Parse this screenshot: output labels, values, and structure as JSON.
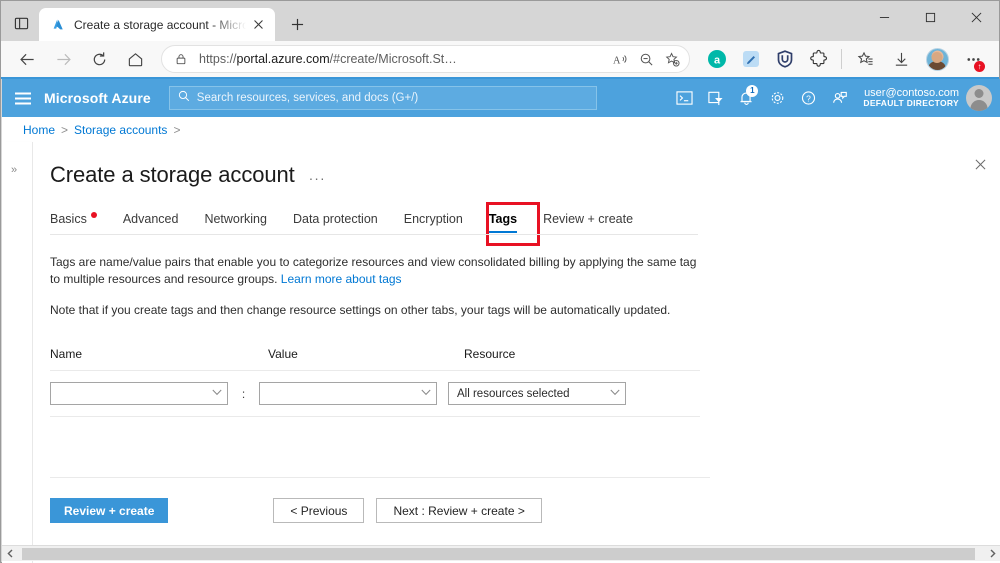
{
  "browser": {
    "tab": {
      "title": "Create a storage account - Micro",
      "favicon_icon": "azure-logo-icon",
      "close_icon": "close-icon"
    },
    "newtab_label": "+",
    "tab_list_icon": "tab-list-icon",
    "window_controls": {
      "minimize": "minimize-icon",
      "maximize": "maximize-icon",
      "close": "close-icon"
    },
    "toolbar": {
      "back_icon": "back-arrow-icon",
      "forward_icon": "forward-arrow-icon",
      "refresh_icon": "refresh-icon",
      "home_icon": "home-icon",
      "lock_icon": "lock-icon",
      "url_prefix": "https://",
      "url_host": "portal.azure.com",
      "url_path": "/#create/Microsoft.St…",
      "read_aloud_icon": "read-aloud-icon",
      "zoom_out_icon": "zoom-out-icon",
      "add_favorite_icon": "add-favorite-icon",
      "extensions": [
        {
          "name": "alexa-extension-icon",
          "letter": "a"
        },
        {
          "name": "editor-extension-icon",
          "letter": ""
        },
        {
          "name": "ublock-extension-icon",
          "letter": ""
        },
        {
          "name": "puzzle-extensions-icon",
          "letter": ""
        }
      ],
      "favorites_icon": "favorites-icon",
      "downloads_icon": "downloads-icon",
      "profile_icon": "profile-avatar-icon",
      "settings_more_icon": "settings-and-more-icon"
    }
  },
  "azure": {
    "header": {
      "menu_icon": "hamburger-menu-icon",
      "brand": "Microsoft Azure",
      "search_placeholder": "Search resources, services, and docs (G+/)",
      "search_value": "",
      "search_icon": "search-icon",
      "icons": [
        {
          "name": "cloud-shell-icon"
        },
        {
          "name": "directories-subscriptions-icon"
        },
        {
          "name": "notifications-bell-icon",
          "badge": "1"
        },
        {
          "name": "settings-gear-icon"
        },
        {
          "name": "help-question-icon"
        },
        {
          "name": "feedback-icon"
        }
      ],
      "account": "user@contoso.com",
      "directory": "DEFAULT DIRECTORY",
      "avatar_icon": "user-avatar-icon"
    },
    "breadcrumb": {
      "items": [
        "Home",
        "Storage accounts"
      ],
      "separator": ">"
    },
    "blade": {
      "title": "Create a storage account",
      "ellipsis": "···",
      "close_icon": "close-blade-icon",
      "rail_expand_icon": "expand-rail-icon",
      "tabs": [
        {
          "label": "Basics",
          "dirty": true,
          "selected": false
        },
        {
          "label": "Advanced",
          "dirty": false,
          "selected": false
        },
        {
          "label": "Networking",
          "dirty": false,
          "selected": false
        },
        {
          "label": "Data protection",
          "dirty": false,
          "selected": false
        },
        {
          "label": "Encryption",
          "dirty": false,
          "selected": false
        },
        {
          "label": "Tags",
          "dirty": false,
          "selected": true
        },
        {
          "label": "Review + create",
          "dirty": false,
          "selected": false
        }
      ],
      "highlight_color": "#e81123",
      "accent_color": "#0078d4",
      "description": {
        "paragraph1_a": "Tags are name/value pairs that enable you to categorize resources and view consolidated billing by applying the same tag to multiple resources and resource groups. ",
        "link": "Learn more about tags",
        "paragraph2": "Note that if you create tags and then change resource settings on other tabs, your tags will be automatically updated."
      },
      "table": {
        "headers": {
          "name": "Name",
          "value": "Value",
          "resource": "Resource"
        },
        "colon": ":",
        "rows": [
          {
            "name_value": "",
            "value_value": "",
            "resource_value": "All resources selected",
            "chevron_icon": "chevron-down-icon"
          }
        ]
      },
      "footer": {
        "review_create": "Review + create",
        "previous": "< Previous",
        "next": "Next : Review + create >"
      }
    }
  },
  "scrollbar": {
    "left_arrow": "scroll-left-icon",
    "right_arrow": "scroll-right-icon"
  }
}
